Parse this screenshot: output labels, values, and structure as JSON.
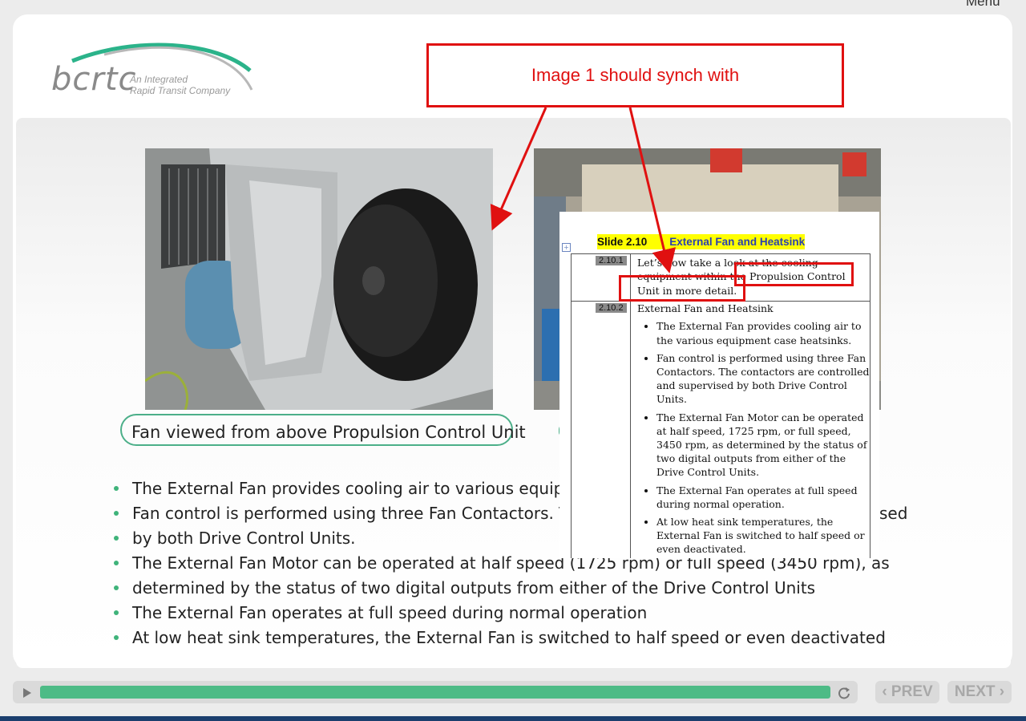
{
  "menu": {
    "label": "Menu"
  },
  "logo": {
    "wordmark": "bcrtc",
    "tagline_line1": "An Integrated",
    "tagline_line2": "Rapid Transit Company"
  },
  "annotation": {
    "text": "Image 1 should synch with"
  },
  "caption": {
    "text": "Fan viewed from above Propulsion Control Unit"
  },
  "bullets": [
    "The External Fan provides cooling air to various equipr",
    "Fan control is performed using three Fan Contactors. T",
    "by both Drive Control Units.",
    "The External Fan Motor can be operated at half speed (1725 rpm) or full speed (3450 rpm), as",
    "determined by the status of two digital outputs from either of the Drive Control Units",
    "The External Fan operates at full speed during normal operation",
    "At low heat sink temperatures, the External Fan is switched to half speed or even deactivated"
  ],
  "bullet_overflow": {
    "sed": "sed"
  },
  "doc": {
    "slide_label": "Slide 2.10",
    "slide_title": "External Fan and Heatsink",
    "row1": {
      "num": "2.10.1",
      "text": "Let’s now take a look at the cooling equipment within the Propulsion Control Unit in more detail."
    },
    "row2": {
      "num": "2.10.2",
      "heading": "External Fan and Heatsink",
      "items": [
        "The External Fan provides cooling air to the various equipment case heatsinks.",
        "Fan control is performed using three Fan Contactors. The contactors are controlled and supervised by both Drive Control Units.",
        "The External Fan Motor can be operated at half speed, 1725 rpm, or full speed, 3450 rpm, as determined by the status of two digital outputs from either of the Drive Control Units.",
        "The External Fan operates at full speed during normal operation.",
        "At low heat sink temperatures, the External Fan is switched to half speed or even deactivated."
      ]
    }
  },
  "player": {
    "progress": 1.0
  },
  "nav": {
    "prev": "PREV",
    "next": "NEXT"
  },
  "colors": {
    "accent": "#4dbb86",
    "annotation_red": "#e01010",
    "highlight_yellow": "#ffff00"
  }
}
